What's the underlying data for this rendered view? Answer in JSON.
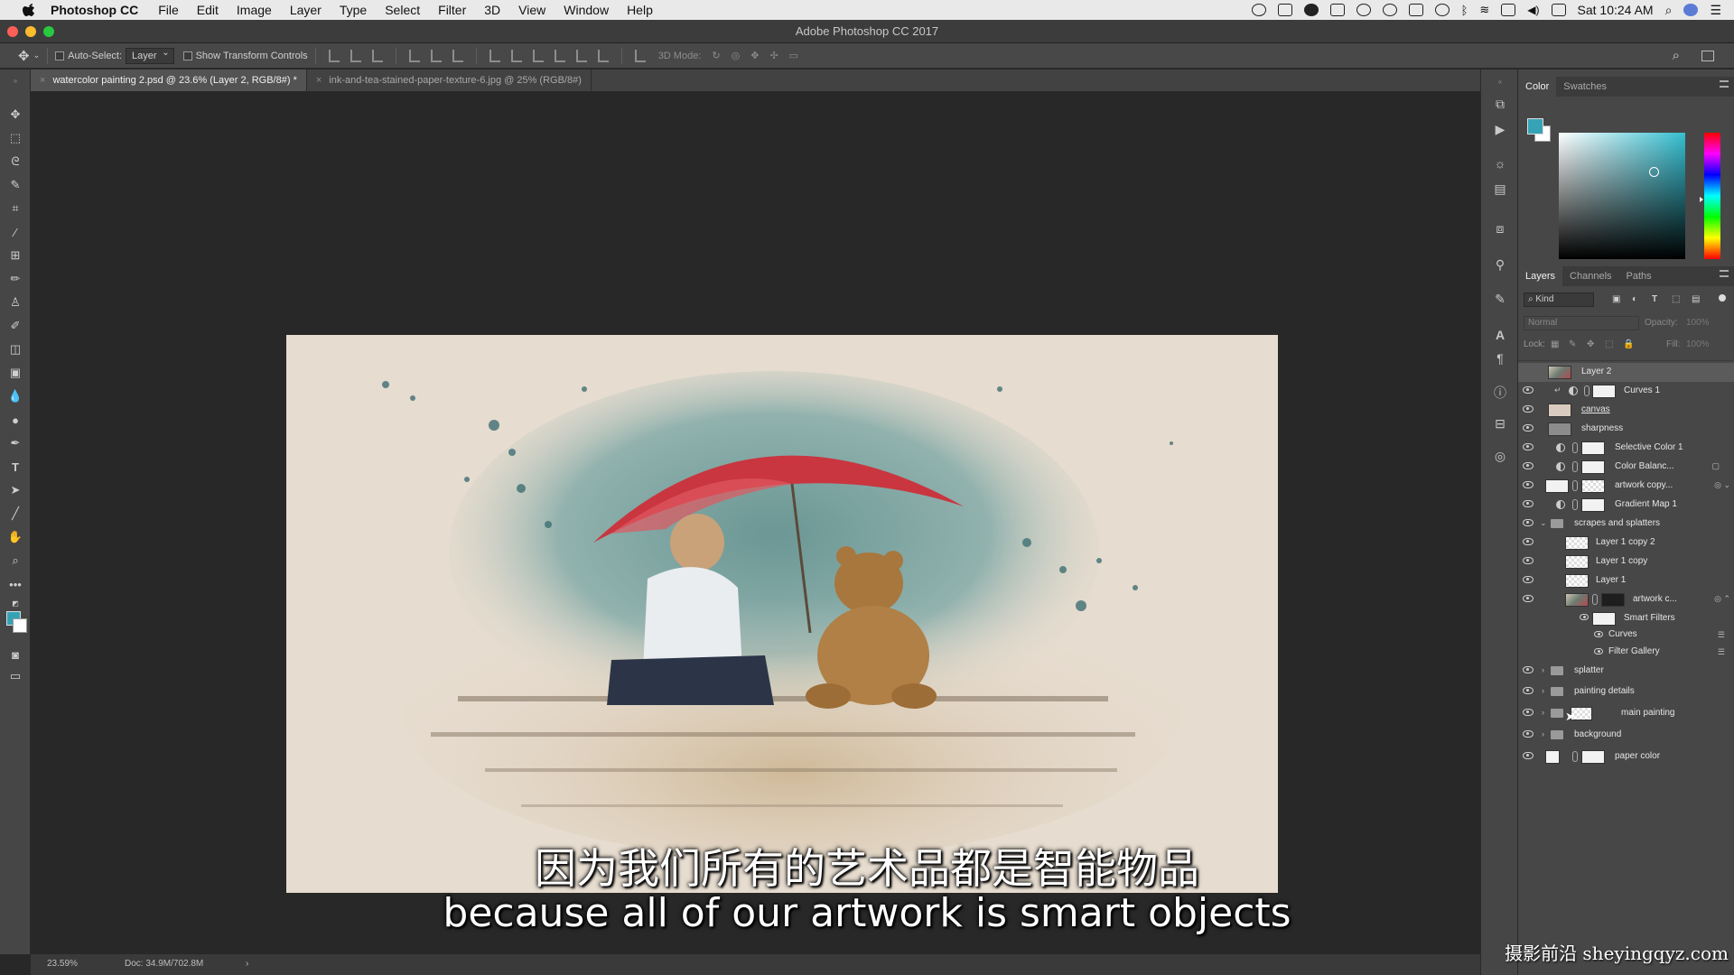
{
  "menubar": {
    "app": "Photoshop CC",
    "items": [
      "File",
      "Edit",
      "Image",
      "Layer",
      "Type",
      "Select",
      "Filter",
      "3D",
      "View",
      "Window",
      "Help"
    ],
    "clock": "Sat 10:24 AM"
  },
  "window": {
    "title": "Adobe Photoshop CC 2017",
    "lights": [
      "#ff5f57",
      "#febc2e",
      "#28c840"
    ]
  },
  "options": {
    "auto_select_label": "Auto-Select:",
    "auto_select_value": "Layer",
    "transform_label": "Show Transform Controls",
    "mode_3d_label": "3D Mode:"
  },
  "tabs": [
    {
      "label": "watercolor painting 2.psd @ 23.6% (Layer 2, RGB/8#) *"
    },
    {
      "label": "ink-and-tea-stained-paper-texture-6.jpg @ 25% (RGB/8#)"
    }
  ],
  "status": {
    "zoom": "23.59%",
    "doc": "Doc: 34.9M/702.8M"
  },
  "subtitles": {
    "chinese": "因为我们所有的艺术品都是智能物品",
    "english": "because all of our artwork is smart objects"
  },
  "watermark": "摄影前沿 sheyingqyz.com",
  "color_panel": {
    "tabs": [
      "Color",
      "Swatches"
    ],
    "foreground": "#35a3b5",
    "background": "#ffffff"
  },
  "layers_panel": {
    "tabs": [
      "Layers",
      "Channels",
      "Paths"
    ],
    "filter_kind": "Kind",
    "blend_mode": "Normal",
    "opacity_label": "Opacity:",
    "opacity_value": "100%",
    "lock_label": "Lock:",
    "fill_label": "Fill:",
    "fill_value": "100%",
    "layers": [
      {
        "name": "Layer 2"
      },
      {
        "name": "Curves 1"
      },
      {
        "name": "canvas"
      },
      {
        "name": "sharpness"
      },
      {
        "name": "Selective Color 1"
      },
      {
        "name": "Color Balanc..."
      },
      {
        "name": "artwork copy..."
      },
      {
        "name": "Gradient Map 1"
      },
      {
        "name": "scrapes and splatters"
      },
      {
        "name": "Layer 1 copy 2"
      },
      {
        "name": "Layer 1 copy"
      },
      {
        "name": "Layer 1"
      },
      {
        "name": "artwork c..."
      },
      {
        "name": "Smart Filters"
      },
      {
        "name": "Curves"
      },
      {
        "name": "Filter Gallery"
      },
      {
        "name": "splatter"
      },
      {
        "name": "painting details"
      },
      {
        "name": "main painting"
      },
      {
        "name": "background"
      },
      {
        "name": "paper color"
      }
    ]
  }
}
